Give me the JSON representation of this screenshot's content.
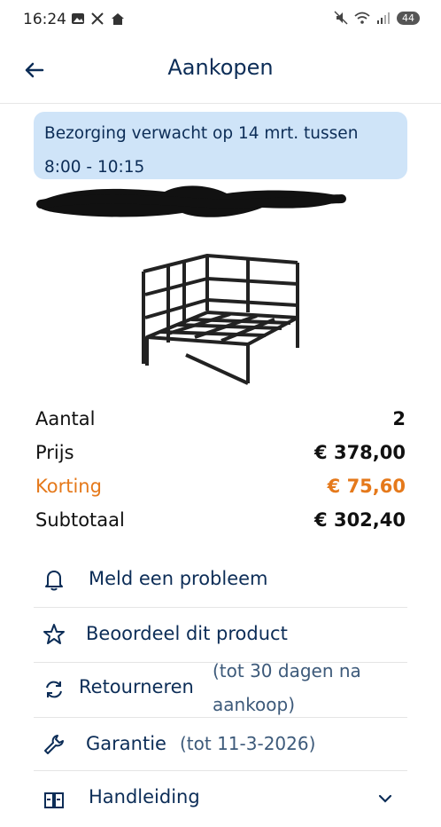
{
  "status": {
    "time": "16:24",
    "battery": "44"
  },
  "header": {
    "title": "Aankopen"
  },
  "delivery": {
    "line1": "Bezorging verwacht op 14 mrt. tussen",
    "line2": "8:00 - 10:15"
  },
  "order_summary": {
    "quantity_label": "Aantal",
    "quantity_value": "2",
    "price_label": "Prijs",
    "price_value": "€ 378,00",
    "discount_label": "Korting",
    "discount_value": "€ 75,60",
    "subtotal_label": "Subtotaal",
    "subtotal_value": "€ 302,40"
  },
  "actions": {
    "report": "Meld een probleem",
    "review": "Beoordeel dit product",
    "return_label": "Retourneren",
    "return_note_1": "(tot 30 dagen na",
    "return_note_2": "aankoop)",
    "warranty_label": "Garantie",
    "warranty_note": "(tot 11-3-2026)",
    "manual_label": "Handleiding"
  },
  "colors": {
    "accent": "#0c2d57",
    "discount": "#e5791b",
    "banner": "#cfe4f8"
  }
}
